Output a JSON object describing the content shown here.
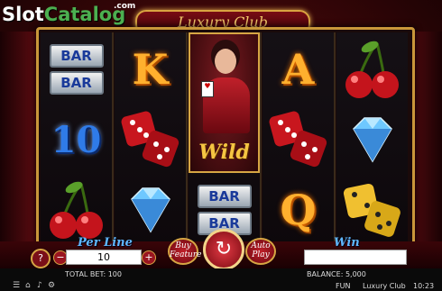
{
  "logo": {
    "slot": "Slot",
    "catalog": "Catalog",
    "com": ".com"
  },
  "game_title": "Luxury Club",
  "reels": [
    [
      {
        "type": "bar",
        "labels": [
          "BAR",
          "BAR"
        ]
      },
      {
        "type": "ten",
        "text": "10"
      },
      {
        "type": "cherry"
      }
    ],
    [
      {
        "type": "letter",
        "text": "K"
      },
      {
        "type": "dice-red"
      },
      {
        "type": "diamond"
      }
    ],
    [
      {
        "type": "wild",
        "text": "Wild"
      },
      {
        "type": "bar",
        "labels": [
          "BAR",
          "BAR"
        ]
      }
    ],
    [
      {
        "type": "letter",
        "text": "A"
      },
      {
        "type": "dice-red"
      },
      {
        "type": "letter",
        "text": "Q"
      }
    ],
    [
      {
        "type": "cherry"
      },
      {
        "type": "diamond"
      },
      {
        "type": "dice-yellow"
      }
    ]
  ],
  "controls": {
    "help": "?",
    "minus": "−",
    "plus": "+",
    "per_line_label": "Per Line",
    "per_line_value": "10",
    "buy_feature": "Buy Feature",
    "spin_icon": "↻",
    "auto_play": "Auto Play",
    "win_label": "Win",
    "win_value": ""
  },
  "status": {
    "total_bet": "TOTAL BET: 100",
    "balance": "BALANCE: 5,000",
    "mode": "FUN",
    "game": "Luxury Club",
    "time": "10:23"
  },
  "icons": [
    "menu-icon",
    "home-icon",
    "sound-icon",
    "settings-icon"
  ],
  "colors": {
    "accent_gold": "#d6a644",
    "label_blue": "#5fb7ff",
    "red": "#c0202a"
  }
}
